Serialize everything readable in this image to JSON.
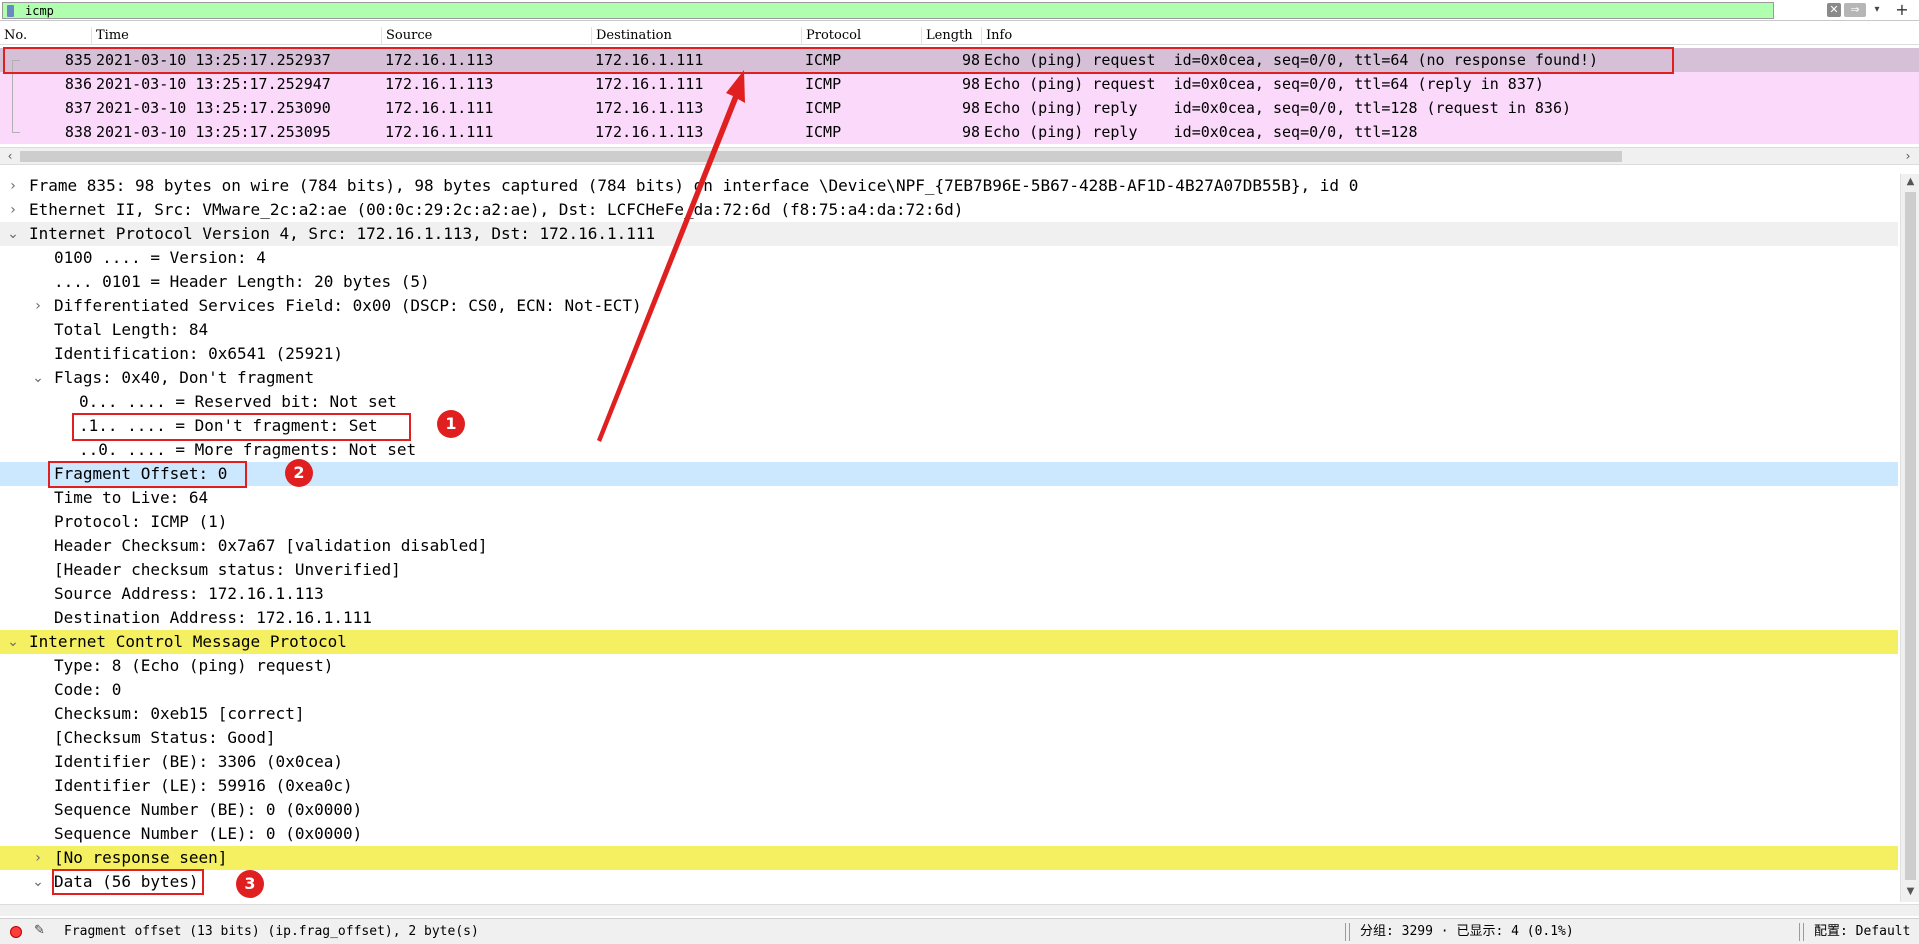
{
  "filter": {
    "value": "icmp",
    "icons": [
      "bookmark-icon",
      "clear-icon",
      "apply-icon",
      "dropdown-icon",
      "plus-icon"
    ],
    "clear_glyph": "✕",
    "apply_glyph": "⇒",
    "dropdown_glyph": "▾",
    "plus_glyph": "+"
  },
  "packet_list": {
    "columns": [
      "No.",
      "Time",
      "Source",
      "Destination",
      "Protocol",
      "Length",
      "Info"
    ],
    "rows": [
      {
        "no": "835",
        "time": "2021-03-10 13:25:17.252937",
        "source": "172.16.1.113",
        "destination": "172.16.1.111",
        "protocol": "ICMP",
        "length": "98",
        "info": "Echo (ping) request  id=0x0cea, seq=0/0, ttl=64 (no response found!)"
      },
      {
        "no": "836",
        "time": "2021-03-10 13:25:17.252947",
        "source": "172.16.1.113",
        "destination": "172.16.1.111",
        "protocol": "ICMP",
        "length": "98",
        "info": "Echo (ping) request  id=0x0cea, seq=0/0, ttl=64 (reply in 837)"
      },
      {
        "no": "837",
        "time": "2021-03-10 13:25:17.253090",
        "source": "172.16.1.111",
        "destination": "172.16.1.113",
        "protocol": "ICMP",
        "length": "98",
        "info": "Echo (ping) reply    id=0x0cea, seq=0/0, ttl=128 (request in 836)"
      },
      {
        "no": "838",
        "time": "2021-03-10 13:25:17.253095",
        "source": "172.16.1.111",
        "destination": "172.16.1.113",
        "protocol": "ICMP",
        "length": "98",
        "info": "Echo (ping) reply    id=0x0cea, seq=0/0, ttl=128"
      }
    ],
    "selected_row": "835"
  },
  "details": {
    "frame": "Frame 835: 98 bytes on wire (784 bits), 98 bytes captured (784 bits) on interface \\Device\\NPF_{7EB7B96E-5B67-428B-AF1D-4B27A07DB55B}, id 0",
    "ethernet": "Ethernet II, Src: VMware_2c:a2:ae (00:0c:29:2c:a2:ae), Dst: LCFCHeFe_da:72:6d (f8:75:a4:da:72:6d)",
    "ip": "Internet Protocol Version 4, Src: 172.16.1.113, Dst: 172.16.1.111",
    "ip_version": "0100 .... = Version: 4",
    "ip_hlen": ".... 0101 = Header Length: 20 bytes (5)",
    "ip_dsf": "Differentiated Services Field: 0x00 (DSCP: CS0, ECN: Not-ECT)",
    "ip_total_len": "Total Length: 84",
    "ip_id": "Identification: 0x6541 (25921)",
    "ip_flags": "Flags: 0x40, Don't fragment",
    "flag_reserved": "0... .... = Reserved bit: Not set",
    "flag_df": ".1.. .... = Don't fragment: Set",
    "flag_mf": "..0. .... = More fragments: Not set",
    "frag_offset": "Fragment Offset: 0",
    "ttl": "Time to Live: 64",
    "protocol": "Protocol: ICMP (1)",
    "checksum": "Header Checksum: 0x7a67 [validation disabled]",
    "checksum_status": "[Header checksum status: Unverified]",
    "src": "Source Address: 172.16.1.113",
    "dst": "Destination Address: 172.16.1.111",
    "icmp": "Internet Control Message Protocol",
    "icmp_type": "Type: 8 (Echo (ping) request)",
    "icmp_code": "Code: 0",
    "icmp_checksum": "Checksum: 0xeb15 [correct]",
    "icmp_checksum_status": "[Checksum Status: Good]",
    "id_be": "Identifier (BE): 3306 (0x0cea)",
    "id_le": "Identifier (LE): 59916 (0xea0c)",
    "seq_be": "Sequence Number (BE): 0 (0x0000)",
    "seq_le": "Sequence Number (LE): 0 (0x0000)",
    "no_response": "[No response seen]",
    "data": "Data (56 bytes)"
  },
  "annotations": {
    "badge1": "1",
    "badge2": "2",
    "badge3": "3",
    "accent_color": "#e02020"
  },
  "status": {
    "field_info": "Fragment offset (13 bits) (ip.frag_offset), 2 byte(s)",
    "packets": "分组: 3299 · 已显示: 4 (0.1%)",
    "profile": "配置: Default"
  },
  "colors": {
    "filter_bg": "#afffaf",
    "icmp_row": "#fad9fa",
    "selected_row": "#d5c0d8",
    "highlight_yellow": "#f5f062",
    "selected_field": "#cce8ff"
  }
}
